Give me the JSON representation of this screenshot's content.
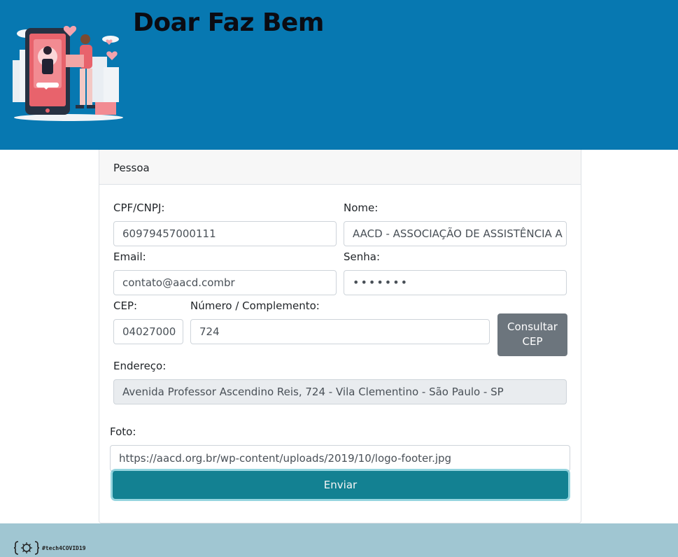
{
  "header": {
    "title": "Doar Faz Bem"
  },
  "form": {
    "card_title": "Pessoa",
    "cpf": {
      "label": "CPF/CNPJ:",
      "value": "60979457000111"
    },
    "nome": {
      "label": "Nome:",
      "value": "AACD - ASSOCIAÇÃO DE ASSISTÊNCIA A C"
    },
    "email": {
      "label": "Email:",
      "value": "contato@aacd.combr"
    },
    "senha": {
      "label": "Senha:",
      "value": "•••••••"
    },
    "cep": {
      "label": "CEP:",
      "value": "04027000"
    },
    "numero": {
      "label": "Número / Complemento:",
      "value": "724"
    },
    "consultar_line1": "Consultar",
    "consultar_line2": "CEP",
    "endereco": {
      "label": "Endereço:",
      "value": "Avenida Professor Ascendino Reis, 724 - Vila Clementino - São Paulo - SP"
    },
    "foto": {
      "label": "Foto:",
      "value": "https://aacd.org.br/wp-content/uploads/2019/10/logo-footer.jpg"
    },
    "submit_label": "Enviar"
  },
  "footer": {
    "tag": "#tech4COVID19"
  },
  "colors": {
    "header_bg": "#0778b1",
    "footer_bg": "#a0c6d2",
    "submit_bg": "#138192",
    "secondary_btn": "#6c757d"
  },
  "icons": {
    "hero": "donation-phone-illustration",
    "footer": "virus-brackets-logo-icon"
  }
}
